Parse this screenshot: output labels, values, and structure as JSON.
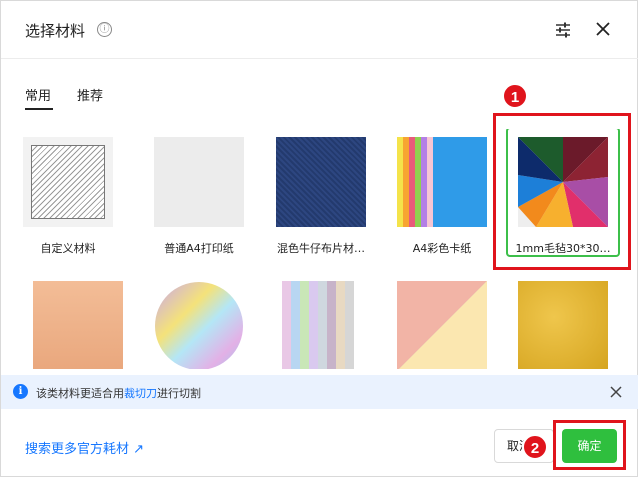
{
  "header": {
    "title": "选择材料",
    "info_icon": "ⓘ",
    "settings_icon": "sliders-icon",
    "close_icon": "close-icon"
  },
  "tabs": [
    {
      "label": "常用",
      "active": true
    },
    {
      "label": "推荐",
      "active": false
    }
  ],
  "materials": [
    {
      "label": "自定义材料",
      "thumb": "hatch-pattern"
    },
    {
      "label": "普通A4打印纸",
      "thumb": "plain-paper"
    },
    {
      "label": "混色牛仔布片材…",
      "thumb": "denim"
    },
    {
      "label": "A4彩色卡纸",
      "thumb": "color-cardstock"
    },
    {
      "label": "1mm毛毡30*30…",
      "thumb": "color-felt",
      "selected": true
    },
    {
      "label": "",
      "thumb": "peach-sheet"
    },
    {
      "label": "",
      "thumb": "holographic-disc"
    },
    {
      "label": "",
      "thumb": "pastel-strips"
    },
    {
      "label": "",
      "thumb": "triangle-sheets"
    },
    {
      "label": "",
      "thumb": "gold-glitter"
    }
  ],
  "notice": {
    "text_before": "该类材料更适合用",
    "link": "裁切刀",
    "text_after": "进行切割"
  },
  "footer": {
    "link": "搜索更多官方耗材 ↗",
    "cancel_label": "取消",
    "confirm_label": "确定"
  },
  "callouts": [
    {
      "number": "1"
    },
    {
      "number": "2"
    }
  ],
  "colors": {
    "accent_green": "#2fbf3e",
    "link_blue": "#1677ff",
    "callout_red": "#e0141c",
    "notice_bg": "#eaf2fe"
  }
}
